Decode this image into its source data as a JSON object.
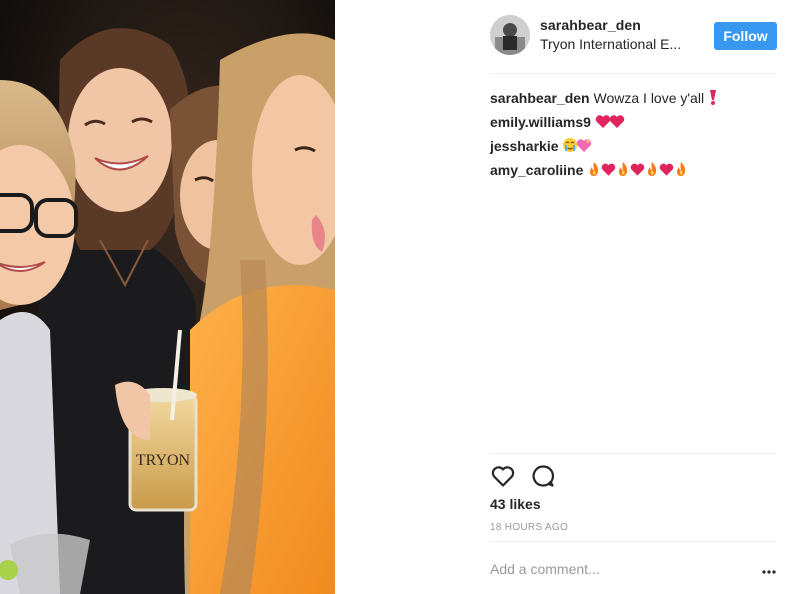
{
  "post": {
    "username": "sarahbear_den",
    "location": "Tryon International E...",
    "follow_label": "Follow"
  },
  "comments": [
    {
      "user": "sarahbear_den",
      "text": "Wowza I love y'all",
      "emoji": [
        "heavy-red-exclamation"
      ]
    },
    {
      "user": "emily.williams9",
      "text": "",
      "emoji": [
        "red-heart",
        "red-heart"
      ]
    },
    {
      "user": "jessharkie",
      "text": "",
      "emoji": [
        "crying-face",
        "sparkling-heart"
      ]
    },
    {
      "user": "amy_caroliine",
      "text": "",
      "emoji": [
        "fire",
        "red-heart",
        "fire",
        "red-heart",
        "fire",
        "red-heart",
        "fire"
      ]
    }
  ],
  "actions": {
    "like_icon": "heart-outline-icon",
    "comment_icon": "speech-bubble-icon",
    "likes": "43 likes",
    "time": "18 HOURS AGO"
  },
  "add_comment": {
    "placeholder": "Add a comment...",
    "more_icon": "more-options-icon"
  },
  "photo": {
    "description_icon": "group-selfie-photo",
    "cup_text": "TRYON"
  },
  "colors": {
    "follow_bg": "#3897f0",
    "text": "#262626",
    "muted": "#999999",
    "divider": "#efefef",
    "heart": "#e0245e"
  }
}
